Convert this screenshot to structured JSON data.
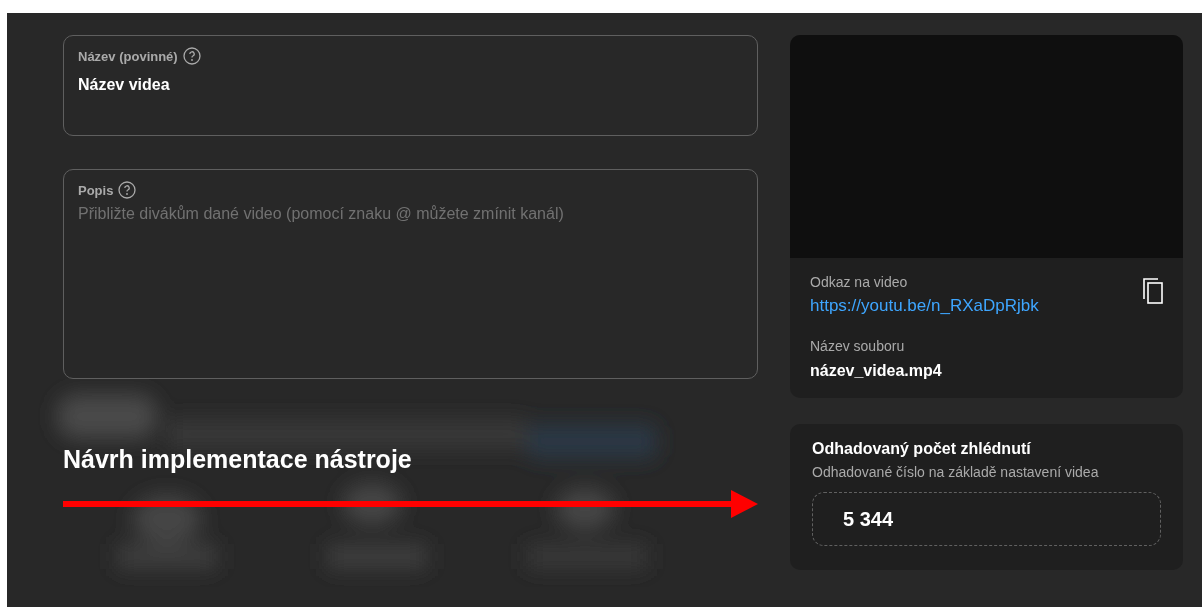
{
  "title_field": {
    "label": "Název (povinné)",
    "value": "Název videa"
  },
  "description_field": {
    "label": "Popis",
    "placeholder": "Přibližte divákům dané video (pomocí znaku @ můžete zmínit kanál)"
  },
  "annotation": {
    "heading": "Návrh implementace nástroje"
  },
  "video_card": {
    "link_label": "Odkaz na video",
    "link": "https://youtu.be/n_RXaDpRjbk",
    "file_label": "Název souboru",
    "file_name": "název_videa.mp4"
  },
  "views_card": {
    "title": "Odhadovaný počet zhlédnutí",
    "subtitle": "Odhadované číslo na základě nastavení videa",
    "value": "5 344"
  }
}
